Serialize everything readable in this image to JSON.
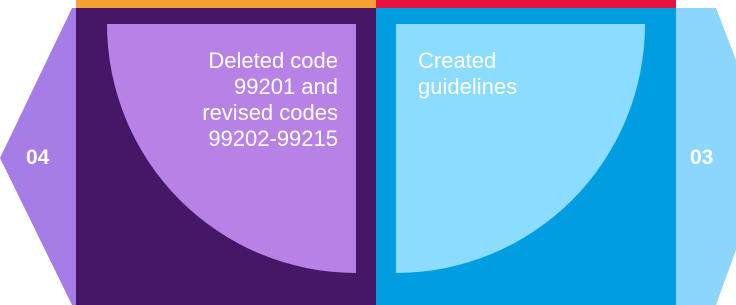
{
  "steps": [
    {
      "number": "04",
      "text": "Deleted code 99201 and revised codes 99202-99215",
      "text_lines": [
        "Deleted code",
        "99201 and",
        "revised codes",
        "99202-99215"
      ]
    },
    {
      "number": "03",
      "text": "Created guidelines",
      "text_lines": [
        "Created",
        "guidelines"
      ]
    }
  ],
  "colors": {
    "left_hex": "#a67de6",
    "left_panel": "#451766",
    "left_quarter": "#b781e6",
    "left_top_bar": "#f5a233",
    "right_hex": "#8dd6fb",
    "right_panel": "#009ee0",
    "right_quarter": "#8bdcff",
    "right_top_bar": "#e8123f",
    "left_text": "#ffffff",
    "right_text": "#ffffff"
  }
}
